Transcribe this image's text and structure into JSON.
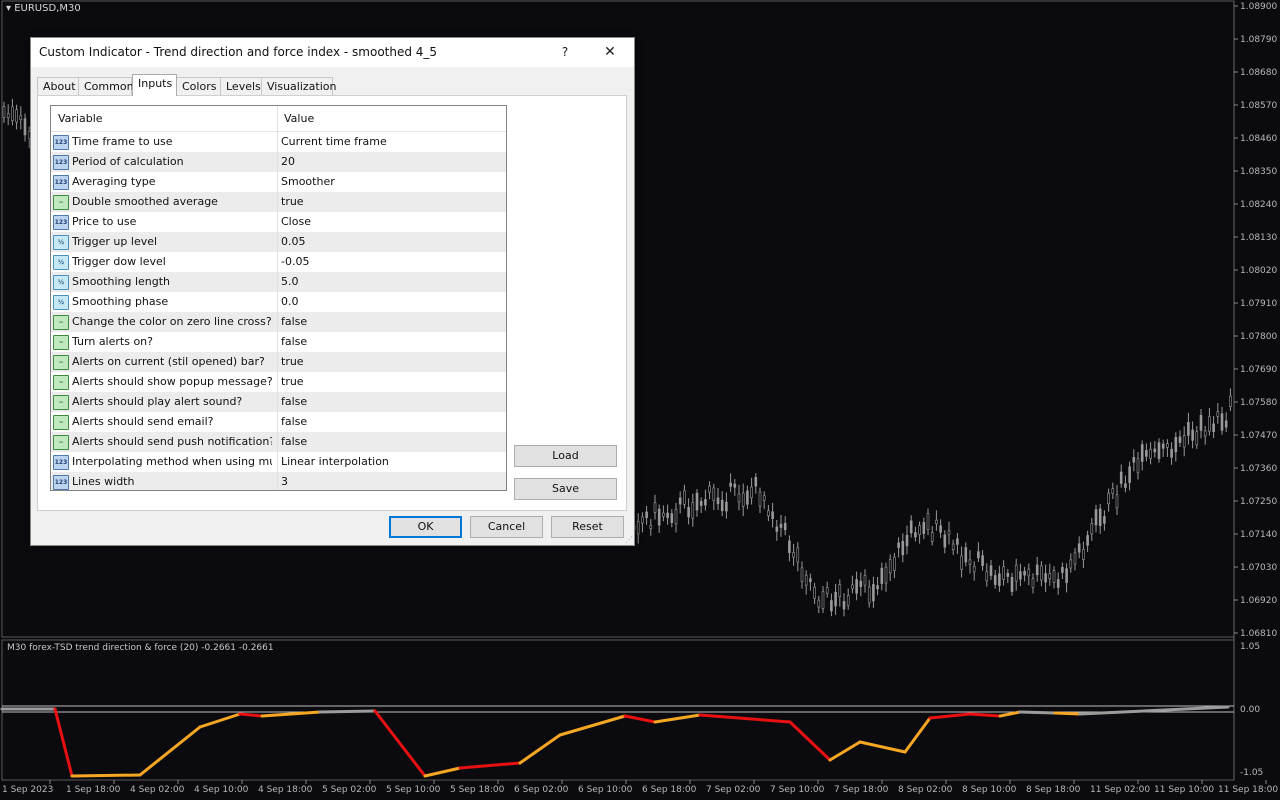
{
  "chart": {
    "symbol": "EURUSD,M30",
    "indicator_label": "M30 forex-TSD trend direction & force (20) -0.2661 -0.2661",
    "price_labels": [
      "1.08900",
      "1.08790",
      "1.08680",
      "1.08570",
      "1.08460",
      "1.08350",
      "1.08240",
      "1.08130",
      "1.08020",
      "1.07910",
      "1.07800",
      "1.07690",
      "1.07580",
      "1.07470",
      "1.07360",
      "1.07250",
      "1.07140",
      "1.07030",
      "1.06920",
      "1.06810"
    ],
    "indicator_scale": [
      "1.05",
      "0.00",
      "-1.05"
    ],
    "time_labels": [
      "1 Sep 2023",
      "1 Sep 18:00",
      "4 Sep 02:00",
      "4 Sep 10:00",
      "4 Sep 18:00",
      "5 Sep 02:00",
      "5 Sep 10:00",
      "5 Sep 18:00",
      "6 Sep 02:00",
      "6 Sep 10:00",
      "6 Sep 18:00",
      "7 Sep 02:00",
      "7 Sep 10:00",
      "7 Sep 18:00",
      "8 Sep 02:00",
      "8 Sep 10:00",
      "8 Sep 18:00",
      "11 Sep 02:00",
      "11 Sep 10:00",
      "11 Sep 18:00"
    ],
    "colors": {
      "background": "#0b0b0f",
      "candles": "#9a9a9a",
      "down_trend": "#e81010",
      "up_trend": "#f5a623",
      "neutral": "#9c9c9c"
    }
  },
  "dialog": {
    "title": "Custom Indicator - Trend direction and force index - smoothed 4_5",
    "help_button": "?",
    "close_button": "✕",
    "tabs": [
      "About",
      "Common",
      "Inputs",
      "Colors",
      "Levels",
      "Visualization"
    ],
    "active_tab": "Inputs",
    "columns": {
      "variable": "Variable",
      "value": "Value"
    },
    "rows": [
      {
        "icon": "int",
        "variable": "Time frame to use",
        "value": "Current time frame"
      },
      {
        "icon": "int",
        "variable": "Period of calculation",
        "value": "20"
      },
      {
        "icon": "int",
        "variable": "Averaging type",
        "value": "Smoother"
      },
      {
        "icon": "bool",
        "variable": "Double smoothed average",
        "value": "true"
      },
      {
        "icon": "int",
        "variable": "Price to use",
        "value": "Close"
      },
      {
        "icon": "dbl",
        "variable": "Trigger up level",
        "value": "0.05"
      },
      {
        "icon": "dbl",
        "variable": "Trigger dow level",
        "value": "-0.05"
      },
      {
        "icon": "dbl",
        "variable": "Smoothing length",
        "value": "5.0"
      },
      {
        "icon": "dbl",
        "variable": "Smoothing phase",
        "value": "0.0"
      },
      {
        "icon": "bool",
        "variable": "Change the color on zero line cross?",
        "value": "false"
      },
      {
        "icon": "bool",
        "variable": "Turn alerts on?",
        "value": "false"
      },
      {
        "icon": "bool",
        "variable": "Alerts on current (stil opened) bar?",
        "value": "true"
      },
      {
        "icon": "bool",
        "variable": "Alerts should show popup message?",
        "value": "true"
      },
      {
        "icon": "bool",
        "variable": "Alerts should play alert sound?",
        "value": "false"
      },
      {
        "icon": "bool",
        "variable": "Alerts should send email?",
        "value": "false"
      },
      {
        "icon": "bool",
        "variable": "Alerts should send push notification?",
        "value": "false"
      },
      {
        "icon": "int",
        "variable": "Interpolating method when using multi ti...",
        "value": "Linear interpolation"
      },
      {
        "icon": "int",
        "variable": "Lines width",
        "value": "3"
      }
    ],
    "icon_glyphs": {
      "int": "123",
      "bool": "~",
      "dbl": "½"
    },
    "buttons": {
      "load": "Load",
      "save": "Save",
      "ok": "OK",
      "cancel": "Cancel",
      "reset": "Reset"
    }
  }
}
